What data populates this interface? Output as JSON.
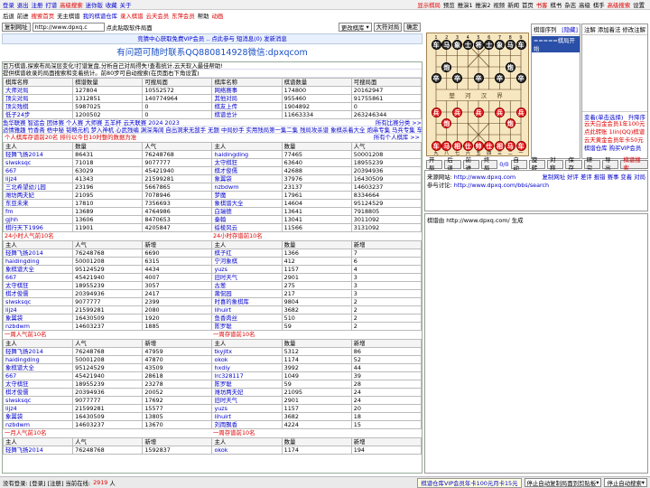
{
  "top": {
    "left": [
      "登录",
      "退出",
      "注册",
      "打谱",
      "高级搜索",
      "迷你版",
      "收藏",
      "关于"
    ],
    "right": [
      "显示棋局",
      "预览",
      "推演1",
      "推演2",
      "视频",
      "新闻",
      "首页",
      "书客",
      "棋书",
      "杂志",
      "高级",
      "棋手",
      "高级搜索",
      "设置"
    ]
  },
  "nav": [
    "后退",
    "前进",
    "搜索首页",
    "无主棋谱",
    "我的棋谱仓库",
    "录入棋谱",
    "云天会员",
    "东萍会员",
    "帮助",
    "动画"
  ],
  "url": {
    "copy": "复制网址",
    "value": "http://www.dpxq.c",
    "hint": "点此贴取软件局面",
    "select": "更改棋库",
    "large": "大符对局",
    "ok": "确定"
  },
  "notice": "竞猜中心获取免费VIP会员 .. 点此参与 短消息(0) 发新消息",
  "headline": "有问题可随时联系QQ880814928微信:dpxqcom",
  "intro": [
    "百万棋谱,探索布局深层变化!打谱复盘,分析自己对局得失!查看统计,云天软入最佳帮助!",
    "提供棋谱收录的局面搜索和变着统计。前80步可自动搜索(在页面右下角设置)"
  ],
  "stats": {
    "headers": [
      "棋库名称",
      "棋谱数量",
      "可搜局面",
      "棋库名称",
      "棋谱数量",
      "可搜局面"
    ],
    "rows": [
      [
        "大师对局",
        "127804",
        "10552572",
        "网络赛事",
        "174800",
        "20162947"
      ],
      [
        "顶尖对局",
        "1312851",
        "140774964",
        "其他对局",
        "955460",
        "91755861"
      ],
      [
        "顶尖残棋",
        "5987025",
        "0",
        "棋友上传",
        "1904892",
        "0"
      ],
      [
        "低子24步",
        "1200502",
        "0",
        "棋谱总计",
        "11663334",
        "263246344"
      ]
    ]
  },
  "links1": "鱼华联赛 智运会 团体赛 个人赛 大师赛 五羊杯 云天联赛 2024 2023",
  "links1r": "所有比赛分类 >>",
  "links2": "适情雅趣 竹香斋 梧中秘 韬略元机 梦入神机 心武残编 渊深海阔 自出洞来无敌手 无题 中局妙手 实用残局第一集二集 残局攻杀谱 象棋杀着大全 炮串专集 马兵专集 车马专集",
  "sec1": {
    "title": "个人棋库存谱前20名 排行以今日10时整的数据为准",
    "more": "所有个人棋库 >>",
    "headers": [
      "主人",
      "数量",
      "人气",
      "主人",
      "数量",
      "人气"
    ],
    "rows": [
      [
        "轻舞飞扬2014",
        "86431",
        "76248768",
        "haidingding",
        "77465",
        "50001208"
      ],
      [
        "slwsksqc",
        "71018",
        "9077777",
        "太守棋狂",
        "63640",
        "18955239"
      ],
      [
        "667",
        "63029",
        "45421940",
        "棋才俊儒",
        "42688",
        "20394936"
      ],
      [
        "lijz4",
        "41343",
        "21599281",
        "象翼袋",
        "37976",
        "16430509"
      ],
      [
        "三北希望幼儿园",
        "23196",
        "5667865",
        "nzbdwm",
        "23137",
        "14603237"
      ],
      [
        "潍坊两夫妃",
        "21095",
        "7078946",
        "梦魔",
        "17961",
        "8334664"
      ],
      [
        "东亚未来",
        "17810",
        "7356693",
        "象棋谱大全",
        "14604",
        "95124529"
      ],
      [
        "fm",
        "13689",
        "4764986",
        "白瑞德",
        "13641",
        "7918805"
      ],
      [
        "gjhh",
        "13606",
        "8470653",
        "秦翰",
        "13041",
        "3011092"
      ],
      [
        "棋行天下1996",
        "11901",
        "4205847",
        "绥棱风云",
        "11566",
        "3131092"
      ]
    ]
  },
  "sec2": {
    "title": "24小时人气前10名",
    "title2": "24小时存谱前10名",
    "headers": [
      "主人",
      "人气",
      "新增",
      "主人",
      "数量",
      "新增"
    ],
    "rows": [
      [
        "轻舞飞扬2014",
        "76248768",
        "6690",
        "棋子红",
        "1366",
        "7"
      ],
      [
        "haidingding",
        "50001208",
        "6315",
        "宁河象棋",
        "412",
        "6"
      ],
      [
        "象棋谱大全",
        "95124529",
        "4434",
        "yuzs",
        "1157",
        "4"
      ],
      [
        "667",
        "45421940",
        "4007",
        "旧时天气",
        "2901",
        "3"
      ],
      [
        "太守棋狂",
        "18955239",
        "3057",
        "古葱",
        "275",
        "3"
      ],
      [
        "棋才俊儒",
        "20394936",
        "2417",
        "莆侃园",
        "217",
        "3"
      ],
      [
        "slwsksqc",
        "9077777",
        "2399",
        "时喜的象棋库",
        "9804",
        "2"
      ],
      [
        "lijz4",
        "21599281",
        "2080",
        "lihuirt",
        "3682",
        "2"
      ],
      [
        "象翼袋",
        "16430509",
        "1920",
        "鱼香肉丝",
        "510",
        "2"
      ],
      [
        "nzbdwm",
        "14603237",
        "1885",
        "陈罗聪",
        "59",
        "2"
      ]
    ]
  },
  "sec3": {
    "title": "一周人气前10名",
    "title2": "一周存谱前10名",
    "headers": [
      "主人",
      "人气",
      "新增",
      "主人",
      "数量",
      "新增"
    ],
    "rows": [
      [
        "轻舞飞扬2014",
        "76248768",
        "47959",
        "tkyjltx",
        "5312",
        "86"
      ],
      [
        "haidingding",
        "50001208",
        "47870",
        "okok",
        "1174",
        "52"
      ],
      [
        "象棋谱大全",
        "95124529",
        "43509",
        "hxdiy",
        "3992",
        "44"
      ],
      [
        "667",
        "45421940",
        "28618",
        "lrc328117",
        "1049",
        "39"
      ],
      [
        "太守棋狂",
        "18955239",
        "23278",
        "陈罗聪",
        "59",
        "28"
      ],
      [
        "棋才俊儒",
        "20394936",
        "20052",
        "潍坊两夫妃",
        "21095",
        "24"
      ],
      [
        "slwsksqc",
        "9077777",
        "17692",
        "旧时天气",
        "2901",
        "24"
      ],
      [
        "lijz4",
        "21599281",
        "15577",
        "yuzs",
        "1157",
        "20"
      ],
      [
        "象翼袋",
        "16430509",
        "13805",
        "lihuirt",
        "3682",
        "18"
      ],
      [
        "nzbdwm",
        "14603237",
        "13670",
        "刘雨飘香",
        "4224",
        "15"
      ]
    ]
  },
  "sec4": {
    "title": "一月人气前10名",
    "title2": "一周存谱前10名",
    "headers": [
      "主人",
      "人气",
      "新增",
      "主人",
      "数量",
      "新增"
    ],
    "rows": [
      [
        "轻舞飞扬2014",
        "76248768",
        "1592837",
        "okok",
        "1174",
        "194"
      ]
    ]
  },
  "bottom": {
    "left": "没有登录: [登录] [注册] 当前在线:",
    "online": "2919",
    "unit": "人",
    "vip": "棋谱仓库VIP会员年卡100元月卡15元",
    "dd1": "停止自动复制局面到剪贴板",
    "dd2": "停止自动搜索"
  },
  "board": {
    "files": [
      "1",
      "2",
      "3",
      "4",
      "5",
      "6",
      "7",
      "8",
      "9"
    ],
    "files_cn": [
      "九",
      "八",
      "七",
      "六",
      "五",
      "四",
      "三",
      "二",
      "一"
    ],
    "river": [
      "楚",
      "河",
      "汉",
      "界"
    ],
    "black": [
      "车",
      "马",
      "象",
      "士",
      "将",
      "士",
      "象",
      "马",
      "车"
    ],
    "black_pieces": [
      {
        "c": "炮",
        "f": 1,
        "r": 2
      },
      {
        "c": "炮",
        "f": 7,
        "r": 2
      },
      {
        "c": "卒",
        "f": 0,
        "r": 3
      },
      {
        "c": "卒",
        "f": 2,
        "r": 3
      },
      {
        "c": "卒",
        "f": 4,
        "r": 3
      },
      {
        "c": "卒",
        "f": 6,
        "r": 3
      },
      {
        "c": "卒",
        "f": 8,
        "r": 3
      }
    ],
    "red": [
      "车",
      "马",
      "相",
      "仕",
      "帅",
      "仕",
      "相",
      "马",
      "车"
    ],
    "red_pieces": [
      {
        "c": "炮",
        "f": 1,
        "r": 7
      },
      {
        "c": "炮",
        "f": 7,
        "r": 7
      },
      {
        "c": "兵",
        "f": 0,
        "r": 6
      },
      {
        "c": "兵",
        "f": 2,
        "r": 6
      },
      {
        "c": "兵",
        "f": 4,
        "r": 6
      },
      {
        "c": "兵",
        "f": 6,
        "r": 6
      },
      {
        "c": "兵",
        "f": 8,
        "r": 6
      }
    ]
  },
  "rp": {
    "title": "棋谱序列",
    "hide": "[隐藏]",
    "item": "=====棋局开始"
  },
  "rp2": {
    "title": "注解 添加着法 修改注解",
    "ads": [
      "云天白金会员1年100元",
      "点此转账 1lin(QQ)棋谱",
      "云天黄金会员年卡50元",
      "棋谱仓库 购买VIP会员"
    ],
    "var": "变着(单击选择)",
    "up": "升降序"
  },
  "ctrl": {
    "row1": [
      "开局",
      "后退",
      "前进",
      "终局",
      "0/0",
      "自动",
      "旋转",
      "对称",
      "保存",
      "研究",
      "导出"
    ],
    "search": "棋谱搜索",
    "row2": [
      "复制网址 打印 播放 发帖 对局 提问"
    ]
  },
  "src": {
    "l1": "来源网站:",
    "u1": "http://www.dpxq.com",
    "l2": "参与讨论:",
    "u2": "http://www.dpxq.com/bbs/search",
    "info": "棋谱由 http://www.dpxq.com/ 生成",
    "tools": "复制网址 好评 差评 报错 赛事 变着 对局"
  }
}
